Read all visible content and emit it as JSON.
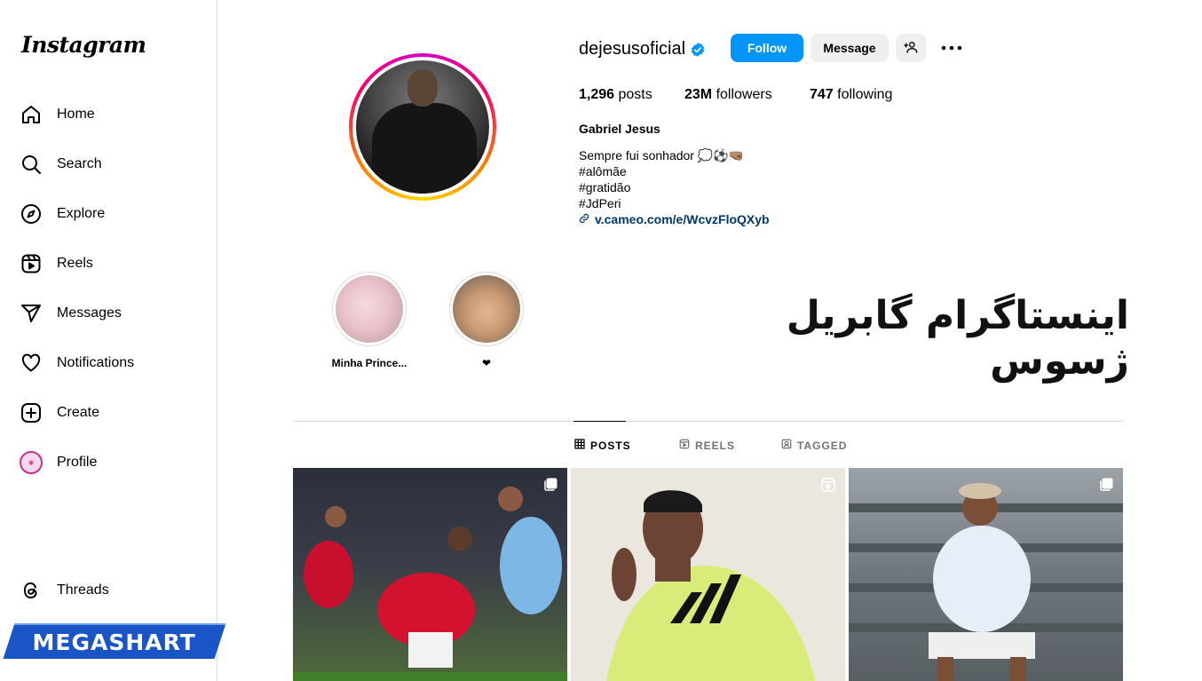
{
  "sidebar": {
    "logo": "Instagram",
    "items": [
      {
        "label": "Home",
        "icon": "home-icon"
      },
      {
        "label": "Search",
        "icon": "search-icon"
      },
      {
        "label": "Explore",
        "icon": "compass-icon"
      },
      {
        "label": "Reels",
        "icon": "reels-icon"
      },
      {
        "label": "Messages",
        "icon": "send-icon"
      },
      {
        "label": "Notifications",
        "icon": "heart-icon"
      },
      {
        "label": "Create",
        "icon": "plus-square-icon"
      },
      {
        "label": "Profile",
        "icon": "avatar"
      }
    ],
    "threads_label": "Threads"
  },
  "watermark": {
    "text": "MEGASHART"
  },
  "profile": {
    "username": "dejesusoficial",
    "verified": true,
    "follow_label": "Follow",
    "message_label": "Message",
    "posts_count": "1,296",
    "posts_word": "posts",
    "followers_count": "23M",
    "followers_word": "followers",
    "following_count": "747",
    "following_word": "following",
    "full_name": "Gabriel Jesus",
    "bio": [
      "Sempre fui sonhador 💭⚽🤜🏽",
      "#alômãe",
      "#gratidão",
      "#JdPeri"
    ],
    "link": "v.cameo.com/e/WcvzFloQXyb"
  },
  "highlights": [
    {
      "label": "Minha Prince..."
    },
    {
      "label": "❤"
    }
  ],
  "overlay_text": "اینستاگرام گابریل ژسوس",
  "tabs": [
    {
      "label": "POSTS",
      "active": true
    },
    {
      "label": "REELS",
      "active": false
    },
    {
      "label": "TAGGED",
      "active": false
    }
  ],
  "colors": {
    "accent": "#0095f6",
    "link": "#00376b",
    "border": "#dbdbdb"
  }
}
